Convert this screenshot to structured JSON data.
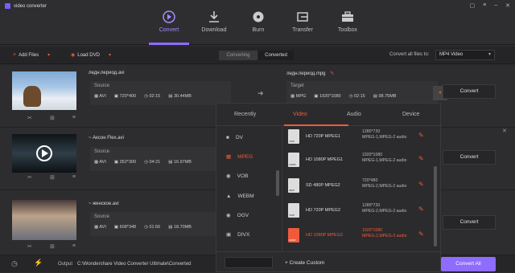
{
  "app": {
    "title": "video converter"
  },
  "nav": {
    "tabs": [
      {
        "label": "Convert",
        "icon": "convert-icon"
      },
      {
        "label": "Download",
        "icon": "download-icon"
      },
      {
        "label": "Burn",
        "icon": "burn-icon"
      },
      {
        "label": "Transfer",
        "icon": "transfer-icon"
      },
      {
        "label": "Toolbox",
        "icon": "toolbox-icon"
      }
    ]
  },
  "toolbar": {
    "add_files": "Add Files",
    "load_dvd": "Load DVD",
    "status_tabs": [
      "Converting",
      "Converted"
    ],
    "convert_all_label": "Convert all files to:",
    "convert_all_value": "MP4 Video"
  },
  "files": [
    {
      "name": "ледн.период.avi",
      "source_label": "Source",
      "format": "AVI",
      "resolution": "720*400",
      "duration": "02:15",
      "size": "30.44MB",
      "target_name": "ледн.период.mpg",
      "target_label": "Target",
      "target_format": "MPG",
      "target_resolution": "1920*1080",
      "target_duration": "02:15",
      "target_size": "98.75MB",
      "convert_label": "Convert"
    },
    {
      "name": "~ Аксон Flex.avi",
      "source_label": "Source",
      "format": "AVI",
      "resolution": "352*300",
      "duration": "04:21",
      "size": "16.97MB",
      "convert_label": "Convert"
    },
    {
      "name": "~ женское.avi",
      "source_label": "Source",
      "format": "AVI",
      "resolution": "608*348",
      "duration": "01:56",
      "size": "18.70MB",
      "convert_label": "Convert"
    }
  ],
  "dropdown": {
    "tabs": [
      "Recently",
      "Video",
      "Audio",
      "Device"
    ],
    "active_tab": "Video",
    "formats": [
      "DV",
      "MPEG",
      "VOB",
      "WEBM",
      "OGV",
      "DIVX"
    ],
    "selected_format": "MPEG",
    "presets": [
      {
        "icon_label": "720P",
        "name": "HD 720P MPEG1",
        "res": "1280*720",
        "codec": "MPEG-1,MPEG-2 audio"
      },
      {
        "icon_label": "1080P",
        "name": "HD 1080P MPEG1",
        "res": "1920*1080",
        "codec": "MPEG-1,MPEG-2 audio"
      },
      {
        "icon_label": "480P",
        "name": "SD 480P MPEG2",
        "res": "720*480",
        "codec": "MPEG-2,MPEG-2 audio"
      },
      {
        "icon_label": "720P",
        "name": "HD 720P MPEG2",
        "res": "1280*720",
        "codec": "MPEG-2,MPEG-2 audio"
      },
      {
        "icon_label": "1080P",
        "name": "HD 1080P MPEG2",
        "res": "1920*1080",
        "codec": "MPEG-2,MPEG-2 audio"
      }
    ],
    "create_custom": "+ Create Custom"
  },
  "bottom": {
    "output_label": "Output",
    "output_path": "C:\\Wondershare Video Converter Ultimate\\Converted",
    "convert_all": "Convert All"
  },
  "colors": {
    "accent": "#8e6cff",
    "highlight": "#f05a3c"
  }
}
